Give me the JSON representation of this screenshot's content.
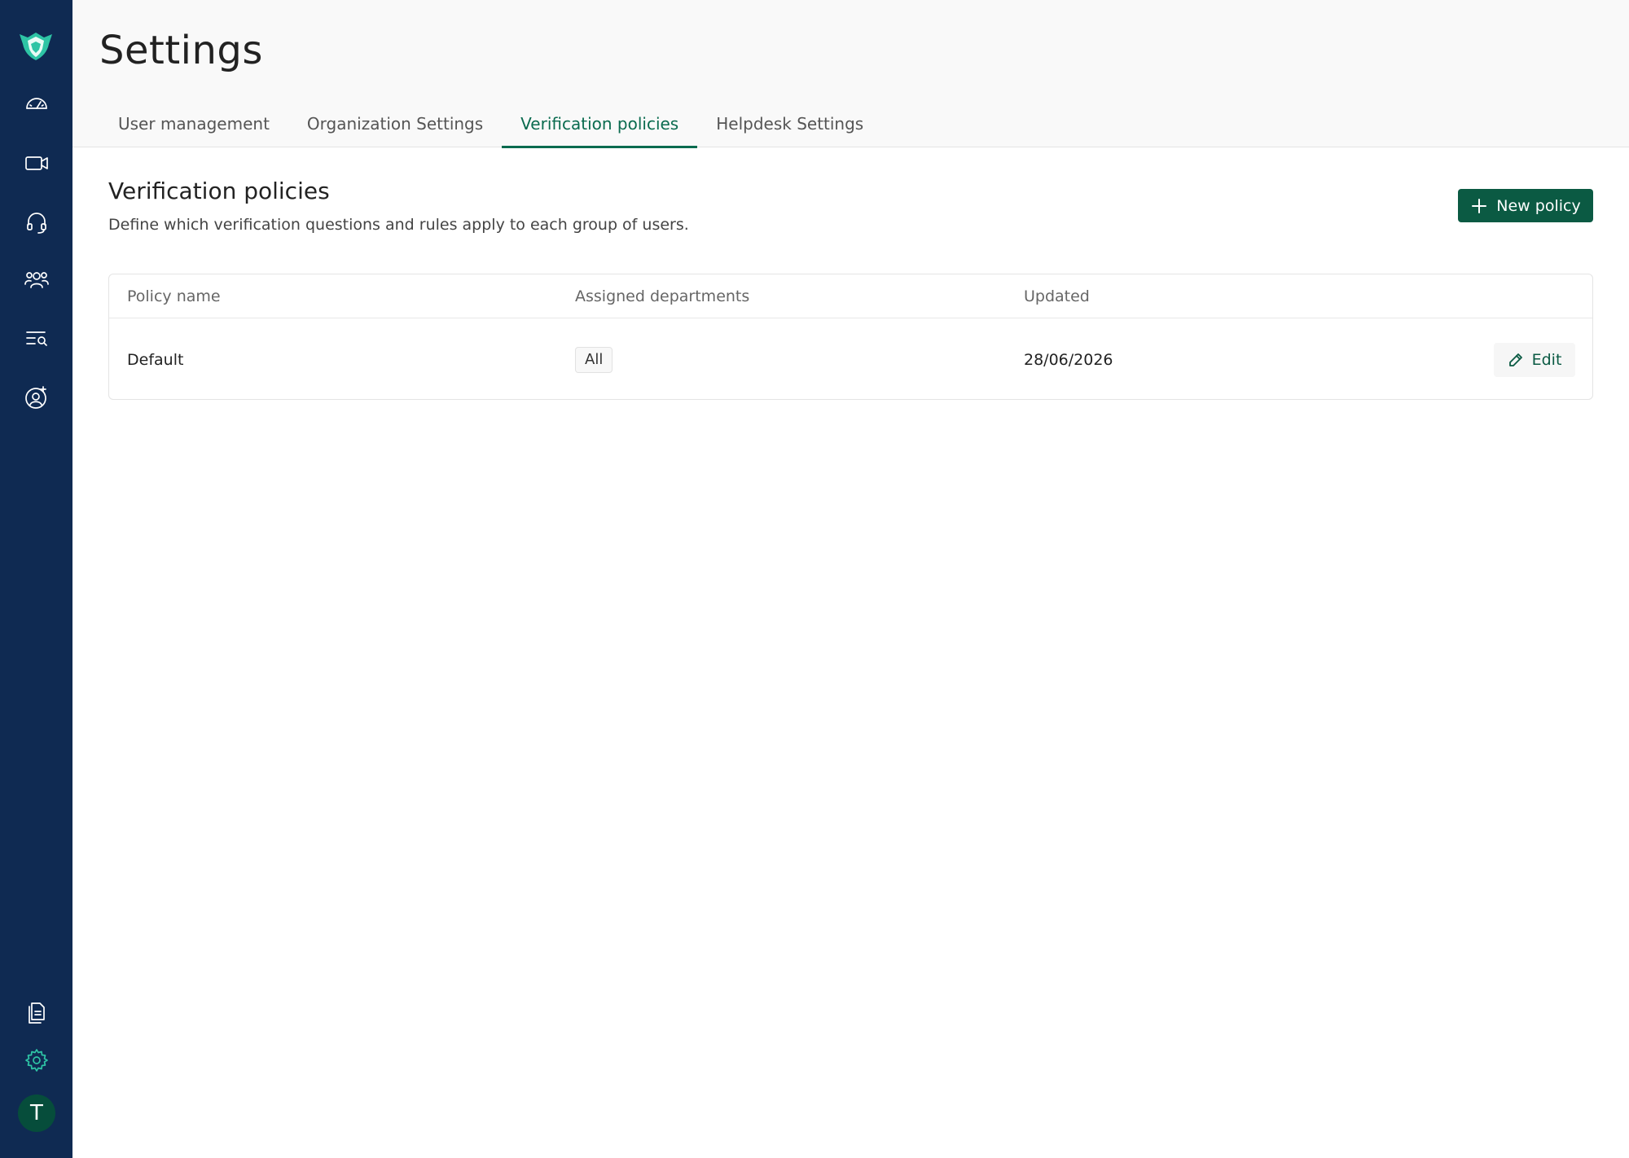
{
  "sidebar": {
    "logo": "shield-logo",
    "items": [
      {
        "icon": "dashboard-gauge-icon"
      },
      {
        "icon": "video-camera-icon"
      },
      {
        "icon": "headset-icon"
      },
      {
        "icon": "users-group-icon"
      },
      {
        "icon": "search-list-icon"
      },
      {
        "icon": "user-add-icon"
      },
      {
        "icon": "documents-icon"
      },
      {
        "icon": "gear-icon"
      }
    ],
    "avatar_initial": "T",
    "active_item": "gear-icon",
    "accent_color": "#2ec4a5",
    "background_color": "#0f2a52"
  },
  "header": {
    "title": "Settings",
    "tabs": [
      {
        "label": "User management",
        "active": false
      },
      {
        "label": "Organization Settings",
        "active": false
      },
      {
        "label": "Verification policies",
        "active": true
      },
      {
        "label": "Helpdesk Settings",
        "active": false
      }
    ]
  },
  "section": {
    "title": "Verification policies",
    "description": "Define which verification questions and rules apply to each group of users.",
    "new_button_label": "New policy"
  },
  "table": {
    "columns": [
      "Policy name",
      "Assigned departments",
      "Updated"
    ],
    "rows": [
      {
        "policy_name": "Default",
        "departments": "All",
        "updated": "28/06/2026",
        "action_label": "Edit"
      }
    ]
  },
  "colors": {
    "primary": "#0b5a43",
    "tab_active": "#0a6b4f"
  }
}
